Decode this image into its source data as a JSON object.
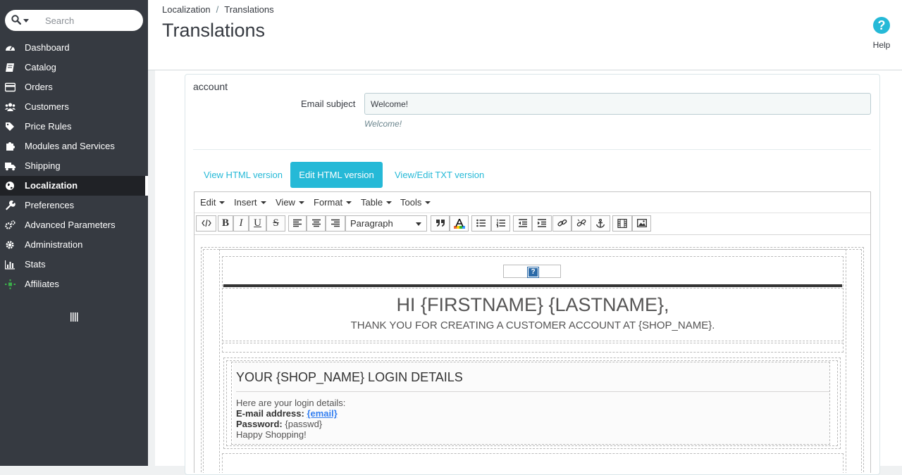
{
  "search": {
    "placeholder": "Search"
  },
  "sidebar": {
    "items": [
      {
        "label": "Dashboard",
        "icon": "dashboard-icon"
      },
      {
        "label": "Catalog",
        "icon": "book-icon"
      },
      {
        "label": "Orders",
        "icon": "credit-card-icon"
      },
      {
        "label": "Customers",
        "icon": "users-icon"
      },
      {
        "label": "Price Rules",
        "icon": "tags-icon"
      },
      {
        "label": "Modules and Services",
        "icon": "puzzle-icon"
      },
      {
        "label": "Shipping",
        "icon": "truck-icon"
      },
      {
        "label": "Localization",
        "icon": "globe-icon",
        "active": true
      },
      {
        "label": "Preferences",
        "icon": "wrench-icon"
      },
      {
        "label": "Advanced Parameters",
        "icon": "cogs-icon"
      },
      {
        "label": "Administration",
        "icon": "gear-icon"
      },
      {
        "label": "Stats",
        "icon": "bar-chart-icon"
      },
      {
        "label": "Affiliates",
        "icon": "affiliates-icon"
      }
    ]
  },
  "header": {
    "breadcrumb": [
      "Localization",
      "Translations"
    ],
    "breadcrumb_sep": "/",
    "title": "Translations",
    "help_label": "Help",
    "help_glyph": "?"
  },
  "form": {
    "section_title": "account",
    "subject_label": "Email subject",
    "subject_value": "Welcome!",
    "subject_hint": "Welcome!"
  },
  "tabs": [
    "View HTML version",
    "Edit HTML version",
    "View/Edit TXT version"
  ],
  "active_tab": "Edit HTML version",
  "editor": {
    "menus": [
      "Edit",
      "Insert",
      "View",
      "Format",
      "Table",
      "Tools"
    ],
    "format_value": "Paragraph",
    "accent_color": "#25b9d7"
  },
  "email": {
    "greeting": "HI {FIRSTNAME} {LASTNAME},",
    "thanks": "THANK YOU FOR CREATING A CUSTOMER ACCOUNT AT {SHOP_NAME}.",
    "login_title": "YOUR {SHOP_NAME} LOGIN DETAILS",
    "intro": "Here are your login details:",
    "email_label": "E-mail address:",
    "email_value": "{email}",
    "password_label": "Password:",
    "password_value": "{passwd}",
    "closing": "Happy Shopping!"
  }
}
